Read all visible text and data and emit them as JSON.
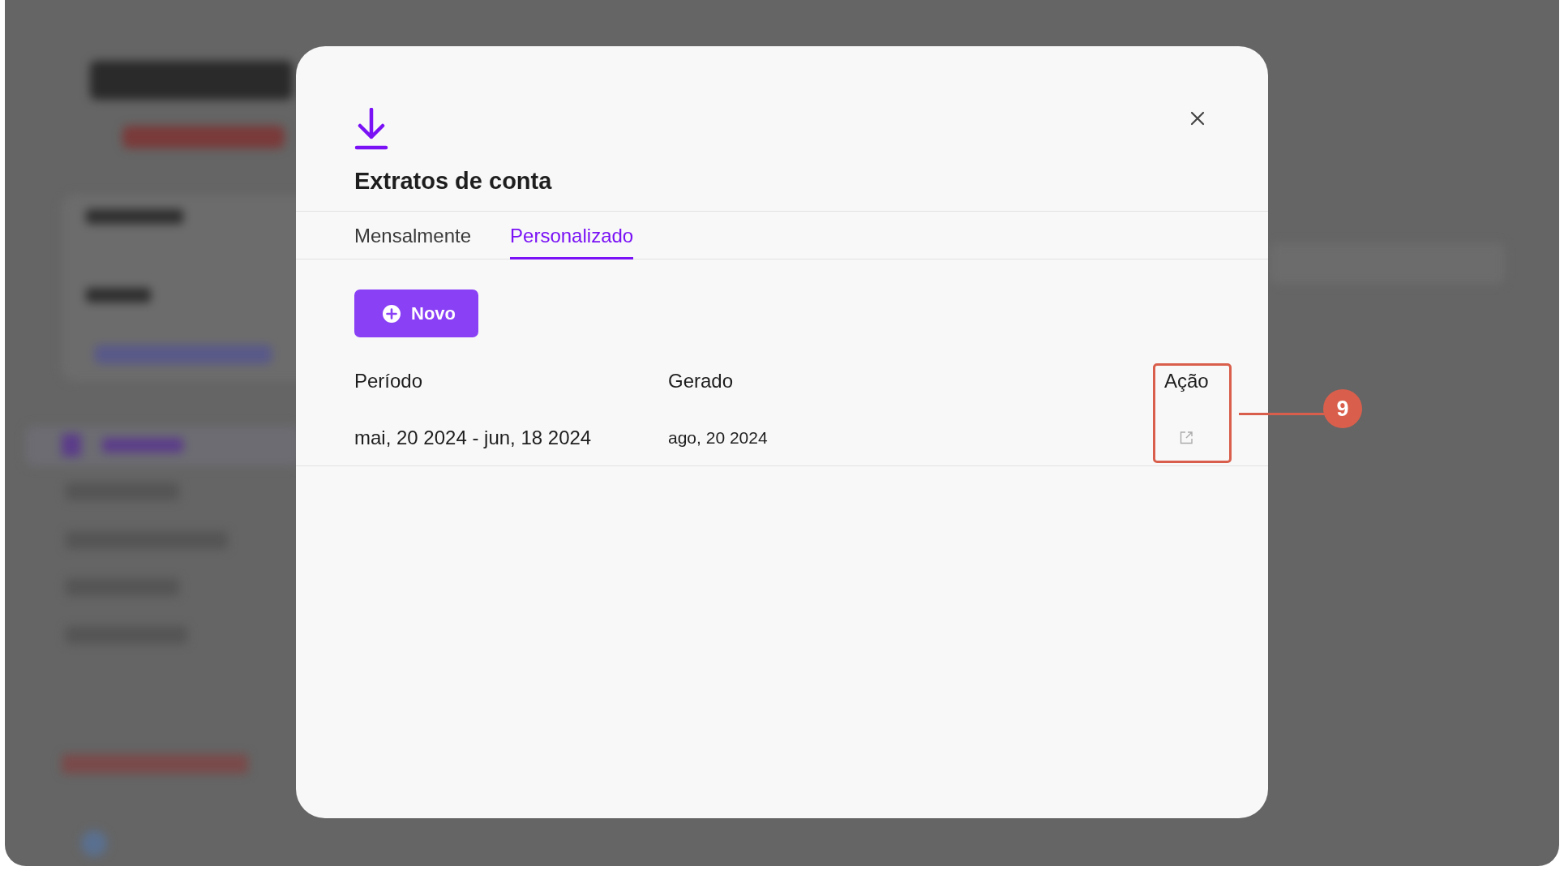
{
  "dialog": {
    "title": "Extratos de conta",
    "tabs": [
      {
        "label": "Mensalmente",
        "selected": false
      },
      {
        "label": "Personalizado",
        "selected": true
      }
    ],
    "new_button": "Novo",
    "table": {
      "columns": [
        "Período",
        "Gerado",
        "Ação"
      ],
      "rows": [
        {
          "period": "mai, 20 2024 - jun, 18 2024",
          "generated": "ago, 20 2024"
        }
      ]
    }
  },
  "annotation": {
    "label": "9"
  }
}
